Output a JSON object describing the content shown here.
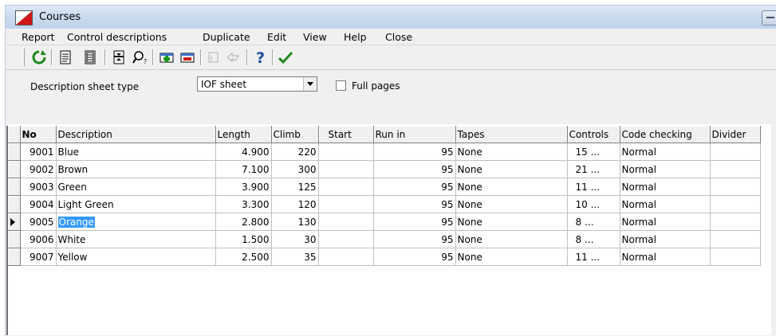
{
  "window": {
    "title": "Courses"
  },
  "menu": [
    "Report",
    "Control descriptions",
    "Duplicate",
    "Edit",
    "View",
    "Help",
    "Close"
  ],
  "toolbar": {
    "icons": [
      "refresh-icon",
      "document-icon",
      "list-icon",
      "print-layout-icon",
      "find-icon",
      "add-course-icon",
      "remove-course-icon",
      "disabled-icon",
      "disabled-icon",
      "help-icon",
      "check-icon"
    ]
  },
  "options": {
    "sheet_label": "Description sheet type",
    "sheet_value": "IOF sheet",
    "full_pages_label": "Full pages",
    "full_pages_checked": false
  },
  "table": {
    "columns": [
      "No",
      "Description",
      "Length",
      "Climb",
      "Start",
      "Run in",
      "Tapes",
      "Controls",
      "Code checking",
      "Divider"
    ],
    "current_row": 4,
    "rows": [
      {
        "no": "9001",
        "description": "Blue",
        "length": "4.900",
        "climb": "220",
        "start": "",
        "runin": "95",
        "tapes": "None",
        "controls": "15 ...",
        "code": "Normal",
        "divider": ""
      },
      {
        "no": "9002",
        "description": "Brown",
        "length": "7.100",
        "climb": "300",
        "start": "",
        "runin": "95",
        "tapes": "None",
        "controls": "21 ...",
        "code": "Normal",
        "divider": ""
      },
      {
        "no": "9003",
        "description": "Green",
        "length": "3.900",
        "climb": "125",
        "start": "",
        "runin": "95",
        "tapes": "None",
        "controls": "11 ...",
        "code": "Normal",
        "divider": ""
      },
      {
        "no": "9004",
        "description": "Light Green",
        "length": "3.300",
        "climb": "120",
        "start": "",
        "runin": "95",
        "tapes": "None",
        "controls": "10 ...",
        "code": "Normal",
        "divider": ""
      },
      {
        "no": "9005",
        "description": "Orange",
        "length": "2.800",
        "climb": "130",
        "start": "",
        "runin": "95",
        "tapes": "None",
        "controls": "8 ...",
        "code": "Normal",
        "divider": ""
      },
      {
        "no": "9006",
        "description": "White",
        "length": "1.500",
        "climb": "30",
        "start": "",
        "runin": "95",
        "tapes": "None",
        "controls": "8 ...",
        "code": "Normal",
        "divider": ""
      },
      {
        "no": "9007",
        "description": "Yellow",
        "length": "2.500",
        "climb": "35",
        "start": "",
        "runin": "95",
        "tapes": "None",
        "controls": "11 ...",
        "code": "Normal",
        "divider": ""
      }
    ]
  }
}
